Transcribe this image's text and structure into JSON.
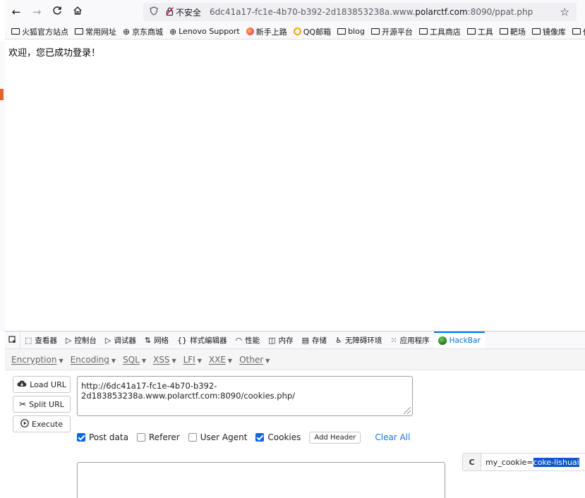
{
  "browser": {
    "nav": {
      "back_icon": "←",
      "forward_icon": "→",
      "reload_icon": "C",
      "home_icon": "⌂"
    },
    "url_bar": {
      "security_label": "不安全",
      "url_prefix": "6dc41a17-fc1e-4b70-b392-2d183853238a.www.",
      "url_domain": "polarctf.com",
      "url_suffix": ":8090/ppat.php"
    },
    "bookmarks": [
      {
        "label": "火狐官方站点",
        "icon": "folder"
      },
      {
        "label": "常用网址",
        "icon": "folder"
      },
      {
        "label": "京东商城",
        "icon": "globe"
      },
      {
        "label": "Lenovo Support",
        "icon": "globe"
      },
      {
        "label": "新手上路",
        "icon": "firefox"
      },
      {
        "label": "QQ邮箱",
        "icon": "qq"
      },
      {
        "label": "blog",
        "icon": "folder"
      },
      {
        "label": "开源平台",
        "icon": "folder"
      },
      {
        "label": "工具商店",
        "icon": "folder"
      },
      {
        "label": "工具",
        "icon": "folder"
      },
      {
        "label": "靶场",
        "icon": "folder"
      },
      {
        "label": "镜像库",
        "icon": "folder"
      },
      {
        "label": "作业平",
        "icon": "folder"
      }
    ]
  },
  "page": {
    "welcome_text": "欢迎，您已成功登录！"
  },
  "devtools": {
    "tabs": [
      {
        "label": "查看器",
        "icon": "inspector-icon",
        "glyph": "⬚"
      },
      {
        "label": "控制台",
        "icon": "console-icon",
        "glyph": "▷"
      },
      {
        "label": "调试器",
        "icon": "debugger-icon",
        "glyph": "▷"
      },
      {
        "label": "网络",
        "icon": "network-icon",
        "glyph": "⇅"
      },
      {
        "label": "样式编辑器",
        "icon": "style-editor-icon",
        "glyph": "{}"
      },
      {
        "label": "性能",
        "icon": "performance-icon",
        "glyph": "◠"
      },
      {
        "label": "内存",
        "icon": "memory-icon",
        "glyph": "◫"
      },
      {
        "label": "存储",
        "icon": "storage-icon",
        "glyph": "▤"
      },
      {
        "label": "无障碍环境",
        "icon": "accessibility-icon",
        "glyph": "♿"
      },
      {
        "label": "应用程序",
        "icon": "application-icon",
        "glyph": "⁙"
      },
      {
        "label": "HackBar",
        "icon": "hackbar-icon",
        "glyph": ""
      }
    ],
    "active_tab": "HackBar"
  },
  "hackbar": {
    "menus": [
      "Encryption",
      "Encoding",
      "SQL",
      "XSS",
      "LFI",
      "XXE",
      "Other"
    ],
    "buttons": {
      "load_url": "Load URL",
      "split_url": "Split URL",
      "execute": "Execute"
    },
    "url_value": "http://6dc41a17-fc1e-4b70-b392-2d183853238a.www.polarctf.com:8090/cookies.php/",
    "options": [
      {
        "label": "Post data",
        "checked": true
      },
      {
        "label": "Referer",
        "checked": false
      },
      {
        "label": "User Agent",
        "checked": false
      },
      {
        "label": "Cookies",
        "checked": true
      }
    ],
    "add_header": "Add Header",
    "clear_all": "Clear All",
    "cookie": {
      "label": "C",
      "key_part": "my_cookie=",
      "selected_part": "coke-lishuai"
    },
    "post_body": ""
  }
}
